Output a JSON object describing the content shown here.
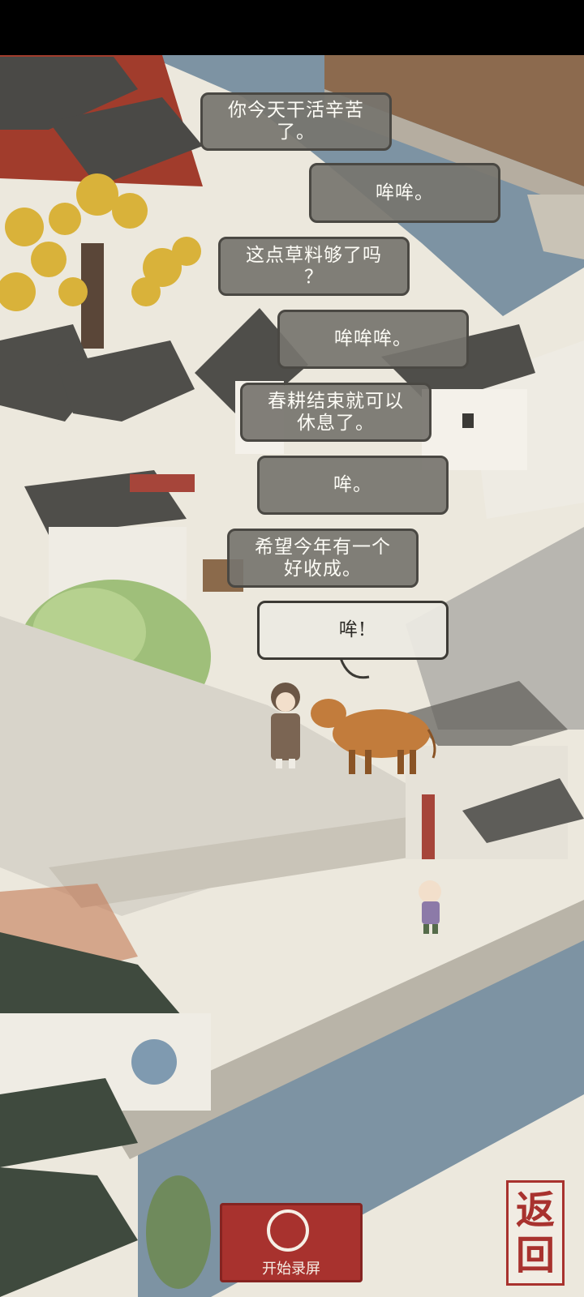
{
  "dialogue": [
    {
      "lines": [
        "你今天干活辛苦",
        "了。"
      ],
      "speaker": "farmer"
    },
    {
      "lines": [
        "哞哞。"
      ],
      "speaker": "ox"
    },
    {
      "lines": [
        "这点草料够了吗",
        "？"
      ],
      "speaker": "farmer"
    },
    {
      "lines": [
        "哞哞哞。"
      ],
      "speaker": "ox"
    },
    {
      "lines": [
        "春耕结束就可以",
        "休息了。"
      ],
      "speaker": "farmer"
    },
    {
      "lines": [
        "哞。"
      ],
      "speaker": "ox"
    },
    {
      "lines": [
        "希望今年有一个",
        "好收成。"
      ],
      "speaker": "farmer"
    },
    {
      "lines": [
        "哞!"
      ],
      "speaker": "ox"
    }
  ],
  "controls": {
    "record_label": "开始录屏",
    "back_label_top": "返",
    "back_label_bottom": "回"
  },
  "colors": {
    "accent_red": "#a8322e",
    "water": "#7d93a3",
    "roof": "#4d4c49",
    "paper": "#ece8dd"
  },
  "icons": {
    "record": "record-circle-icon"
  }
}
